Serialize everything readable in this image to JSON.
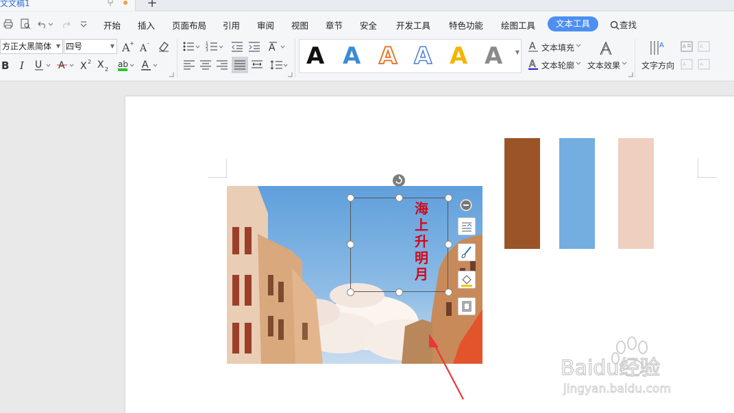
{
  "titlebar": {
    "doc_tab": "文文稿1",
    "new_tab": "+"
  },
  "menu": {
    "items": [
      "开始",
      "插入",
      "页面布局",
      "引用",
      "审阅",
      "视图",
      "章节",
      "安全",
      "开发工具",
      "特色功能",
      "绘图工具"
    ],
    "active": "文本工具",
    "find": "查找"
  },
  "ribbon": {
    "font_name": "方正大黑简体",
    "font_size": "四号",
    "style_letters": [
      "A",
      "A",
      "A",
      "A",
      "A",
      "A"
    ],
    "text_fill": "文本填充",
    "text_outline": "文本轮廓",
    "text_effect": "文本效果",
    "text_direction": "文字方向"
  },
  "document": {
    "textbox_text": [
      "海",
      "上",
      "升",
      "明",
      "月"
    ]
  },
  "swatches": [
    "#9b5427",
    "#74ade0",
    "#efcfc0"
  ],
  "colors": {
    "accent": "#4d8ff0",
    "text_red": "#d00818",
    "arrow_red": "#e8363a"
  },
  "watermark": {
    "brand": "Baidu经验",
    "url": "jingyan.baidu.com"
  }
}
